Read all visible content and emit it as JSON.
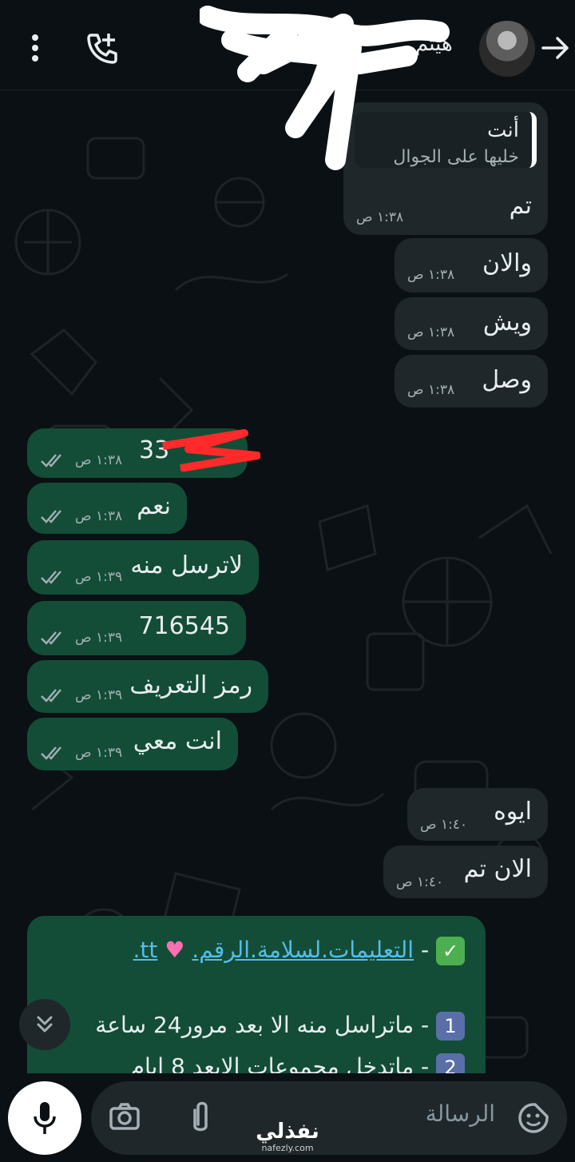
{
  "header": {
    "contact_name": "هيثم",
    "icons": [
      "back-arrow-icon",
      "add-call-icon",
      "more-options-icon"
    ]
  },
  "messages": [
    {
      "dir": "in",
      "reply_name": "أنت",
      "reply_text": "خليها على الجوال",
      "text": "تم",
      "time": "١:٣٨ ص"
    },
    {
      "dir": "in",
      "text": "والان",
      "time": "١:٣٨ ص"
    },
    {
      "dir": "in",
      "text": "ويش",
      "time": "١:٣٨ ص"
    },
    {
      "dir": "in",
      "text": "وصل",
      "time": "١:٣٨ ص"
    },
    {
      "dir": "out",
      "text": "33",
      "time": "١:٣٨ ص",
      "ticks": "read"
    },
    {
      "dir": "out",
      "text": "نعم",
      "time": "١:٣٨ ص",
      "ticks": "read"
    },
    {
      "dir": "out",
      "text": "لاترسل منه",
      "time": "١:٣٩ ص",
      "ticks": "read"
    },
    {
      "dir": "out",
      "text": "716545",
      "time": "١:٣٩ ص",
      "ticks": "read"
    },
    {
      "dir": "out",
      "text": "رمز التعريف",
      "time": "١:٣٩ ص",
      "ticks": "read"
    },
    {
      "dir": "out",
      "text": "انت معي",
      "time": "١:٣٩ ص",
      "ticks": "read"
    },
    {
      "dir": "in",
      "text": "ايوه",
      "time": "١:٤٠ ص"
    },
    {
      "dir": "in",
      "text": "الان تم",
      "time": "١:٤٠ ص"
    }
  ],
  "long_message": {
    "line1_prefix": "-",
    "line1_link": "التعليمات.لسلامة.الرقم.",
    "line1_suffix": "tt.",
    "line2_num": "1",
    "line2_text": "- ماتراسل منه الا بعد مرور24 ساعة",
    "line3_num": "2",
    "line3_text": "- ماتدخل مجموعات الابعد 8 ايام"
  },
  "composer": {
    "placeholder": "الرسالة"
  },
  "watermark": {
    "arabic": "نفذلي",
    "url": "nafezly.com"
  },
  "colors": {
    "incoming": "#1f272a",
    "outgoing": "#134d37",
    "link": "#53bdeb",
    "background": "#0b1014"
  }
}
